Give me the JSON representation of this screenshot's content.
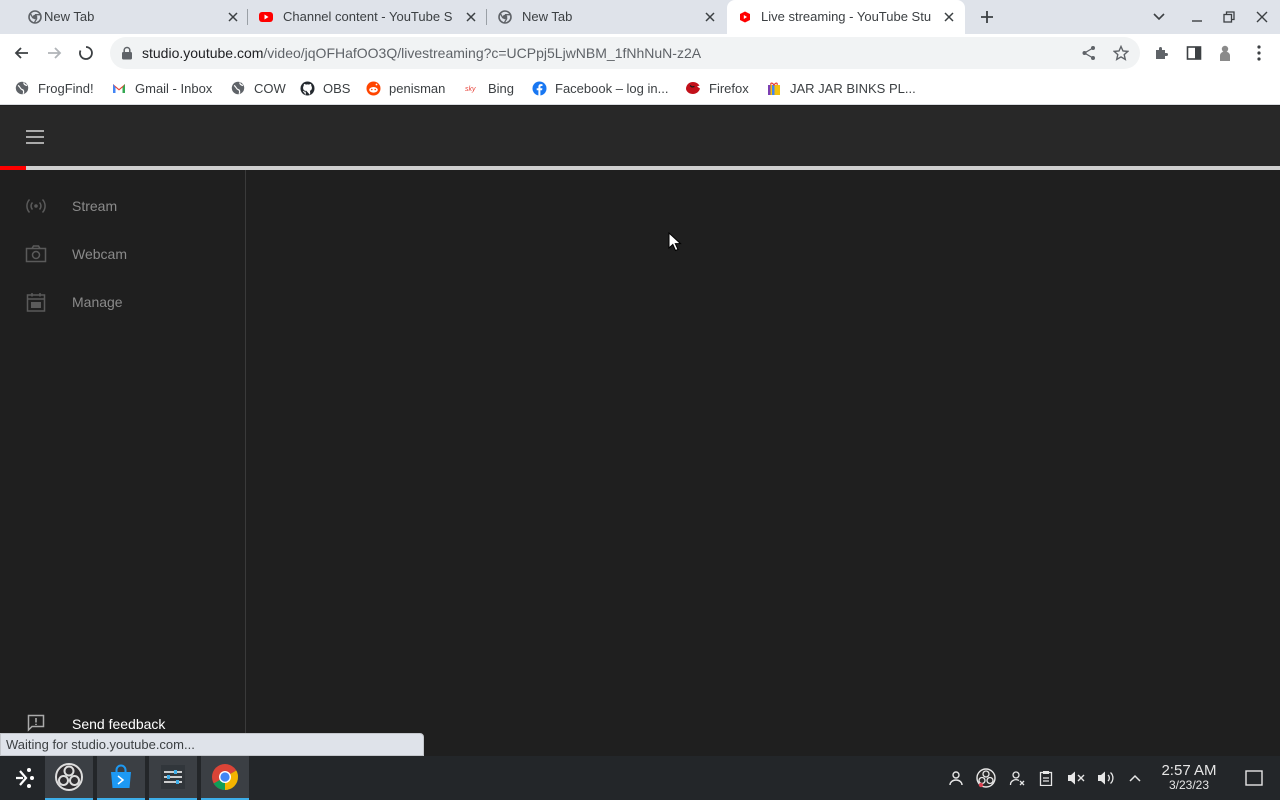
{
  "browser": {
    "tabs": [
      {
        "title": "New Tab",
        "icon": "chrome-icon",
        "active": false
      },
      {
        "title": "Channel content - YouTube S",
        "icon": "youtube-icon",
        "active": false
      },
      {
        "title": "New Tab",
        "icon": "chrome-icon",
        "active": false
      },
      {
        "title": "Live streaming - YouTube Stu",
        "icon": "youtube-studio-icon",
        "active": true
      }
    ],
    "url_host": "studio.youtube.com",
    "url_path": "/video/jqOFHafOO3Q/livestreaming?c=UCPpj5LjwNBM_1fNhNuN-z2A",
    "status_text": "Waiting for studio.youtube.com..."
  },
  "bookmarks": [
    {
      "label": "FrogFind!",
      "icon": "globe-icon"
    },
    {
      "label": "Gmail - Inbox",
      "icon": "gmail-icon"
    },
    {
      "label": "COW",
      "icon": "globe-icon"
    },
    {
      "label": "OBS",
      "icon": "github-icon"
    },
    {
      "label": "penisman",
      "icon": "reddit-icon"
    },
    {
      "label": "Bing",
      "icon": "bing-icon"
    },
    {
      "label": "Facebook – log in...",
      "icon": "facebook-icon"
    },
    {
      "label": "Firefox",
      "icon": "firefox-icon"
    },
    {
      "label": "JAR JAR BINKS PL...",
      "icon": "gift-icon"
    }
  ],
  "studio": {
    "page_load_progress": 0.02,
    "nav": [
      {
        "label": "Stream",
        "icon": "broadcast-icon"
      },
      {
        "label": "Webcam",
        "icon": "camera-icon"
      },
      {
        "label": "Manage",
        "icon": "calendar-icon"
      }
    ],
    "feedback_label": "Send feedback"
  },
  "taskbar": {
    "time": "2:57 AM",
    "date": "3/23/23"
  },
  "colors": {
    "studio_bg": "#1f1f1f",
    "studio_header": "#282828",
    "progress": "#ff0000",
    "tabstrip": "#dfe3ea",
    "taskbar": "#232629"
  }
}
